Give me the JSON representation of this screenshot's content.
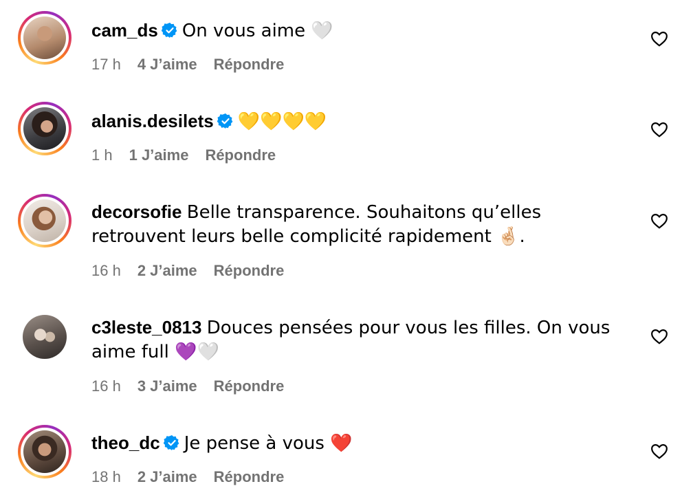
{
  "colors": {
    "meta_gray": "#737373",
    "verified_blue": "#0095f6"
  },
  "comments": [
    {
      "username": "cam_ds",
      "verified": true,
      "text": "On vous aime 🤍",
      "time": "17 h",
      "likes": "4 J’aime",
      "reply": "Répondre",
      "avatar_ring": true
    },
    {
      "username": "alanis.desilets",
      "verified": true,
      "text": "💛💛💛💛",
      "time": "1 h",
      "likes": "1 J’aime",
      "reply": "Répondre",
      "avatar_ring": true
    },
    {
      "username": "decorsofie",
      "verified": false,
      "text": "Belle transparence. Souhaitons qu’elles retrouvent leurs belle complicité rapidement 🤞🏻.",
      "time": "16 h",
      "likes": "2 J’aime",
      "reply": "Répondre",
      "avatar_ring": true
    },
    {
      "username": "c3leste_0813",
      "verified": false,
      "text": "Douces pensées pour vous les filles. On vous aime full 💜🤍",
      "time": "16 h",
      "likes": "3 J’aime",
      "reply": "Répondre",
      "avatar_ring": false
    },
    {
      "username": "theo_dc",
      "verified": true,
      "text": "Je pense à vous ❤️",
      "time": "18 h",
      "likes": "2 J’aime",
      "reply": "Répondre",
      "avatar_ring": true
    }
  ]
}
